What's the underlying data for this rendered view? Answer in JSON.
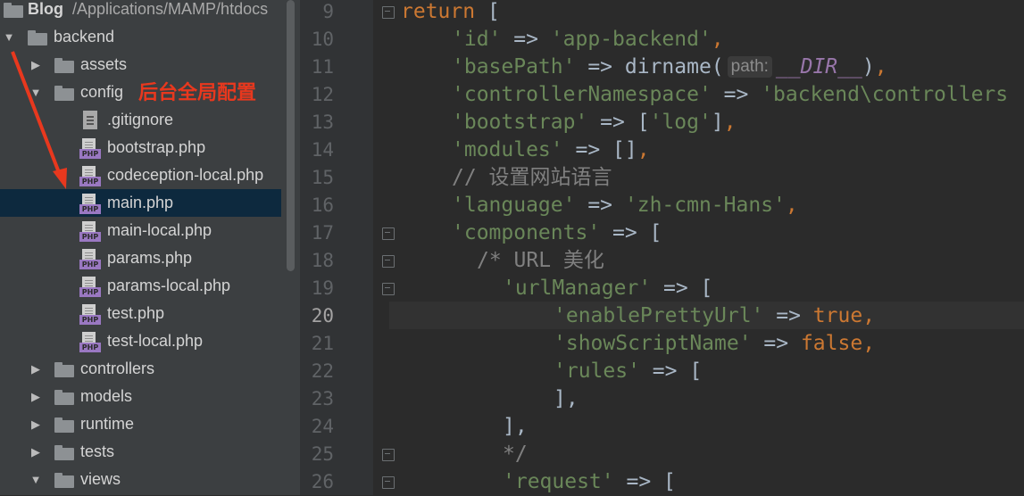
{
  "project_panel": {
    "header": {
      "project": "Blog",
      "path": "/Applications/MAMP/htdocs"
    },
    "items": [
      {
        "label": "backend",
        "type": "folder",
        "expanded": true,
        "depth": 0
      },
      {
        "label": "assets",
        "type": "folder",
        "expanded": false,
        "depth": 1
      },
      {
        "label": "config",
        "type": "folder",
        "expanded": true,
        "depth": 1
      },
      {
        "label": ".gitignore",
        "type": "file",
        "depth": 2
      },
      {
        "label": "bootstrap.php",
        "type": "php",
        "depth": 2
      },
      {
        "label": "codeception-local.php",
        "type": "php",
        "depth": 2
      },
      {
        "label": "main.php",
        "type": "php",
        "depth": 2,
        "selected": true
      },
      {
        "label": "main-local.php",
        "type": "php",
        "depth": 2
      },
      {
        "label": "params.php",
        "type": "php",
        "depth": 2
      },
      {
        "label": "params-local.php",
        "type": "php",
        "depth": 2
      },
      {
        "label": "test.php",
        "type": "php",
        "depth": 2
      },
      {
        "label": "test-local.php",
        "type": "php",
        "depth": 2
      },
      {
        "label": "controllers",
        "type": "folder",
        "expanded": false,
        "depth": 1
      },
      {
        "label": "models",
        "type": "folder",
        "expanded": false,
        "depth": 1
      },
      {
        "label": "runtime",
        "type": "folder",
        "expanded": false,
        "depth": 1
      },
      {
        "label": "tests",
        "type": "folder",
        "expanded": false,
        "depth": 1
      },
      {
        "label": "views",
        "type": "folder",
        "expanded": true,
        "depth": 1
      }
    ],
    "php_badge": "PHP"
  },
  "annotation": {
    "text": "后台全局配置",
    "color": "#e8381e"
  },
  "editor": {
    "current_line": 20,
    "lines": [
      {
        "n": 9,
        "parts": [
          [
            "kw",
            "return"
          ],
          [
            "op",
            " ["
          ]
        ]
      },
      {
        "n": 10,
        "parts": [
          [
            "str",
            "'id'"
          ],
          [
            "op",
            " => "
          ],
          [
            "str",
            "'app-backend'"
          ],
          [
            "kw",
            ","
          ]
        ]
      },
      {
        "n": 11,
        "parts": [
          [
            "str",
            "'basePath'"
          ],
          [
            "op",
            " => "
          ],
          [
            "op",
            "dirname("
          ],
          [
            "hint",
            "path:"
          ],
          [
            "cst",
            "__DIR__"
          ],
          [
            "op",
            ")"
          ],
          [
            "kw",
            ","
          ]
        ]
      },
      {
        "n": 12,
        "parts": [
          [
            "str",
            "'controllerNamespace'"
          ],
          [
            "op",
            " => "
          ],
          [
            "str",
            "'backend\\controllers"
          ]
        ]
      },
      {
        "n": 13,
        "parts": [
          [
            "str",
            "'bootstrap'"
          ],
          [
            "op",
            " => ["
          ],
          [
            "str",
            "'log'"
          ],
          [
            "op",
            "]"
          ],
          [
            "kw",
            ","
          ]
        ]
      },
      {
        "n": 14,
        "parts": [
          [
            "str",
            "'modules'"
          ],
          [
            "op",
            " => []"
          ],
          [
            "kw",
            ","
          ]
        ]
      },
      {
        "n": 15,
        "parts": [
          [
            "cmt",
            "// 设置网站语言"
          ]
        ]
      },
      {
        "n": 16,
        "parts": [
          [
            "str",
            "'language'"
          ],
          [
            "op",
            " => "
          ],
          [
            "str",
            "'zh-cmn-Hans'"
          ],
          [
            "kw",
            ","
          ]
        ]
      },
      {
        "n": 17,
        "parts": [
          [
            "str",
            "'components'"
          ],
          [
            "op",
            " => ["
          ]
        ]
      },
      {
        "n": 18,
        "parts": [
          [
            "cmt",
            "/* URL 美化"
          ]
        ]
      },
      {
        "n": 19,
        "parts": [
          [
            "str",
            "'urlManager'"
          ],
          [
            "op",
            " => ["
          ]
        ]
      },
      {
        "n": 20,
        "parts": [
          [
            "str",
            "'enablePrettyUrl'"
          ],
          [
            "op",
            " => "
          ],
          [
            "kw",
            "true"
          ],
          [
            "kw",
            ","
          ]
        ]
      },
      {
        "n": 21,
        "parts": [
          [
            "str",
            "'showScriptName'"
          ],
          [
            "op",
            " => "
          ],
          [
            "kw",
            "false"
          ],
          [
            "kw",
            ","
          ]
        ]
      },
      {
        "n": 22,
        "parts": [
          [
            "str",
            "'rules'"
          ],
          [
            "op",
            " => ["
          ]
        ]
      },
      {
        "n": 23,
        "parts": [
          [
            "op",
            "],"
          ]
        ]
      },
      {
        "n": 24,
        "parts": [
          [
            "op",
            "],"
          ]
        ]
      },
      {
        "n": 25,
        "parts": [
          [
            "cmt",
            "*/"
          ]
        ]
      },
      {
        "n": 26,
        "parts": [
          [
            "str",
            "'request'"
          ],
          [
            "op",
            " => ["
          ]
        ]
      }
    ]
  }
}
